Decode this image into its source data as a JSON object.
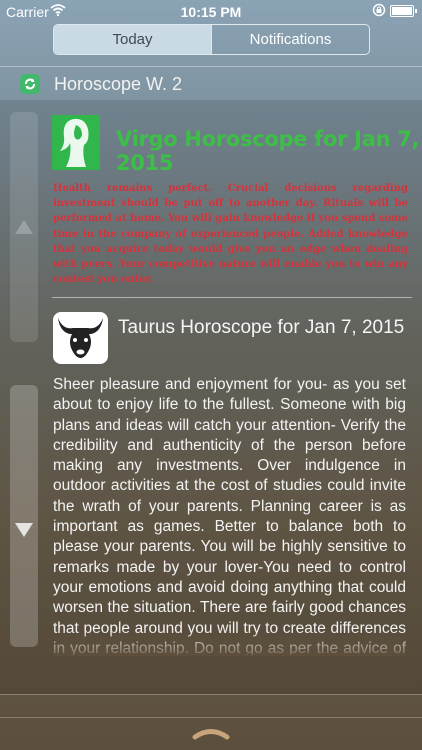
{
  "status_bar": {
    "carrier": "Carrier",
    "time": "10:15 PM"
  },
  "tabs": [
    {
      "label": "Today"
    },
    {
      "label": "Notifications"
    }
  ],
  "widget": {
    "title": "Horoscope W. 2"
  },
  "virgo": {
    "title": "Virgo Horoscope for Jan 7, 2015",
    "body": "Health remains perfect. Crucial decisions regarding investment should be put off to another day. Rituals will be performed at home. You will gain knowledge if you spend some time in the company of experienced people. Added knowledge that you acquire today would give you an edge when dealing with peers. Your competitive nature will enable you to win any contest you enter."
  },
  "taurus": {
    "title": "Taurus Horoscope for Jan 7, 2015",
    "body": "Sheer pleasure and enjoyment for you- as you set about to enjoy life to the fullest. Someone with big plans and ideas will catch your attention- Verify the credibility and authenticity of the person before making any investments. Over indulgence in outdoor activities at the cost of studies could invite the wrath of your parents. Planning career is as important as games. Better to balance both to please your parents. You will be highly sensitive to remarks made by your lover-You need to control your emotions and avoid doing anything that could worsen the situation. There are fairly good chances that people around you will try to create differences in your relationship. Do not go as per the advice of outsiders. Take care of your action"
  },
  "colors": {
    "virgo_green": "#3dbf47",
    "virgo_red": "#d7323b",
    "app_icon_green": "#42b96a"
  },
  "icons": [
    "wifi-icon",
    "lock-rotation-icon",
    "battery-icon",
    "app-icon",
    "virgo-icon",
    "taurus-icon",
    "scroll-up-icon",
    "scroll-down-icon",
    "grabber-icon"
  ]
}
